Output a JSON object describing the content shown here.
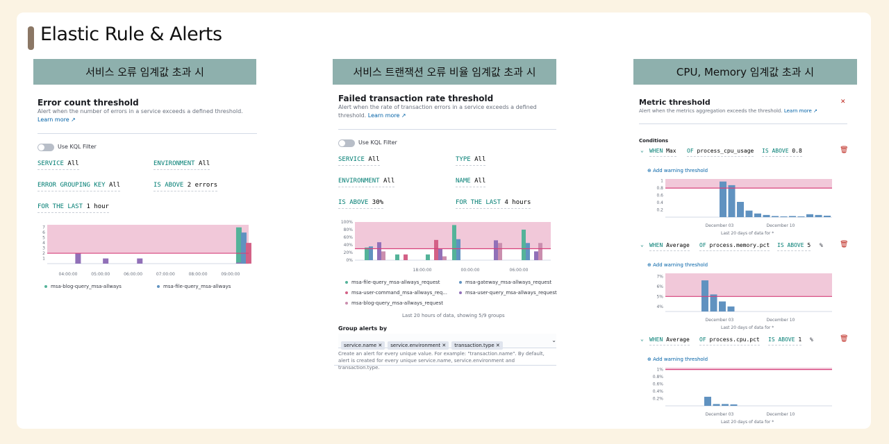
{
  "page_title": "Elastic Rule & Alerts",
  "banners": [
    "서비스 오류 임계값 초과 시",
    "서비스 트랜잭션 오류 비율 임계값 초과 시",
    "CPU, Memory 임계값 초과 시"
  ],
  "panel1": {
    "title": "Error count threshold",
    "description": "Alert when the number of errors in a service exceeds a defined threshold.",
    "learn_more": "Learn more",
    "kql_toggle": "Use KQL Filter",
    "exprs": [
      {
        "k": "SERVICE",
        "v": "All"
      },
      {
        "k": "ENVIRONMENT",
        "v": "All"
      },
      {
        "k": "ERROR GROUPING KEY",
        "v": "All"
      },
      {
        "k": "IS ABOVE",
        "v": "2 errors"
      },
      {
        "k": "FOR THE LAST",
        "v": "1 hour"
      }
    ],
    "legend": [
      "msa-blog-query_msa-allways",
      "msa-file-query_msa-allways"
    ]
  },
  "panel2": {
    "title": "Failed transaction rate threshold",
    "description": "Alert when the rate of transaction errors in a service exceeds a defined threshold.",
    "learn_more": "Learn more",
    "kql_toggle": "Use KQL Filter",
    "exprs": [
      {
        "k": "SERVICE",
        "v": "All"
      },
      {
        "k": "TYPE",
        "v": "All"
      },
      {
        "k": "ENVIRONMENT",
        "v": "All"
      },
      {
        "k": "NAME",
        "v": "All"
      },
      {
        "k": "IS ABOVE",
        "v": "30%"
      },
      {
        "k": "FOR THE LAST",
        "v": "4 hours"
      }
    ],
    "legend": [
      "msa-file-query_msa-allways_request",
      "msa-gateway_msa-allways_request",
      "msa-user-command_msa-allways_req...",
      "msa-user-query_msa-allways_request",
      "msa-blog-query_msa-allways_request"
    ],
    "footnote": "Last 20 hours of data, showing 5/9 groups",
    "group_label": "Group alerts by",
    "chips": [
      "service.name",
      "service.environment",
      "transaction.type"
    ],
    "help": "Create an alert for every unique value. For example: \"transaction.name\". By default, alert is created for every unique service.name, service.environment and transaction.type."
  },
  "panel3": {
    "title": "Metric threshold",
    "description": "Alert when the metrics aggregation exceeds the threshold.",
    "learn_more": "Learn more",
    "conditions_label": "Conditions",
    "add_warning": "Add warning threshold",
    "footnote": "Last 20 days of data for *",
    "conditions": [
      {
        "agg": "Max",
        "field": "process_cpu_usage",
        "threshold": "0.8",
        "unit": ""
      },
      {
        "agg": "Average",
        "field": "process.memory.pct",
        "threshold": "5",
        "unit": "%"
      },
      {
        "agg": "Average",
        "field": "process.cpu.pct",
        "threshold": "1",
        "unit": "%"
      }
    ]
  },
  "colors": {
    "threshold_band": "#f1c8d9",
    "threshold_line": "#d6407a",
    "green": "#54b399",
    "blue": "#6092c0",
    "pink": "#d36086",
    "purple": "#9170b8",
    "lilac": "#ca8eae"
  },
  "chart_data": [
    {
      "type": "bar",
      "title": "Error count threshold",
      "x_ticks": [
        "04:00:00",
        "05:00:00",
        "06:00:00",
        "07:00:00",
        "08:00:00",
        "09:00:00"
      ],
      "y_ticks": [
        "1",
        "2",
        "3",
        "4",
        "5",
        "6",
        "7"
      ],
      "ylim": [
        0,
        7.5
      ],
      "threshold": 2,
      "series": [
        {
          "name": "msa-blog-query_msa-allways",
          "color": "#54b399",
          "points": [
            [
              0.65,
              0
            ],
            [
              5.6,
              7
            ]
          ]
        },
        {
          "name": "msa-file-query_msa-allways",
          "color": "#6092c0",
          "points": [
            [
              5.75,
              6
            ]
          ]
        },
        {
          "color": "#d36086",
          "points": [
            [
              5.9,
              4
            ]
          ]
        },
        {
          "color": "#9170b8",
          "points": [
            [
              0.65,
              2
            ],
            [
              1.5,
              1
            ],
            [
              2.55,
              1
            ],
            [
              5.6,
              0
            ]
          ]
        }
      ]
    },
    {
      "type": "bar",
      "title": "Failed transaction rate threshold",
      "x_ticks": [
        "18:00:00",
        "00:00:00",
        "06:00:00"
      ],
      "y_ticks": [
        "0%",
        "20%",
        "40%",
        "60%",
        "80%",
        "100%"
      ],
      "ylim": [
        0,
        100
      ],
      "threshold": 30,
      "series": [
        {
          "name": "msa-file-query_msa-allways_request",
          "color": "#54b399",
          "values": [
            33,
            15,
            15,
            92,
            0,
            80
          ]
        },
        {
          "name": "msa-gateway_msa-allways_request",
          "color": "#6092c0",
          "values": [
            36,
            0,
            0,
            55,
            0,
            45
          ]
        },
        {
          "name": "msa-user-command_msa-allways_req...",
          "color": "#d36086",
          "values": [
            0,
            15,
            53,
            0,
            0,
            0
          ]
        },
        {
          "name": "msa-user-query_msa-allways_request",
          "color": "#9170b8",
          "values": [
            47,
            0,
            30,
            0,
            52,
            23
          ]
        },
        {
          "name": "msa-blog-query_msa-allways_request",
          "color": "#ca8eae",
          "values": [
            23,
            0,
            10,
            0,
            45,
            45
          ]
        }
      ]
    },
    {
      "type": "bar",
      "title": "Max process_cpu_usage",
      "x_ticks": [
        "December 03",
        "December 10"
      ],
      "y_ticks": [
        "0.2",
        "0.4",
        "0.6",
        "0.8",
        "1"
      ],
      "ylim": [
        0,
        1.05
      ],
      "threshold": 0.8,
      "values": [
        0.98,
        0.88,
        0.42,
        0.18,
        0.1,
        0.06,
        0.03,
        0.02,
        0.03,
        0.02,
        0.08,
        0.06,
        0.04
      ]
    },
    {
      "type": "bar",
      "title": "Average process.memory.pct",
      "x_ticks": [
        "December 03",
        "December 10"
      ],
      "y_ticks": [
        "4%",
        "5%",
        "6%",
        "7%"
      ],
      "ylim": [
        3.5,
        7.3
      ],
      "threshold": 5,
      "values": [
        6.6,
        5.2,
        4.5,
        4.0
      ]
    },
    {
      "type": "bar",
      "title": "Average process.cpu.pct",
      "x_ticks": [
        "December 03",
        "December 10"
      ],
      "y_ticks": [
        "0.2%",
        "0.4%",
        "0.6%",
        "0.8%",
        "1%"
      ],
      "ylim": [
        0,
        1.05
      ],
      "threshold": 1,
      "values": [
        0.25,
        0.05,
        0.05,
        0.04
      ]
    }
  ]
}
